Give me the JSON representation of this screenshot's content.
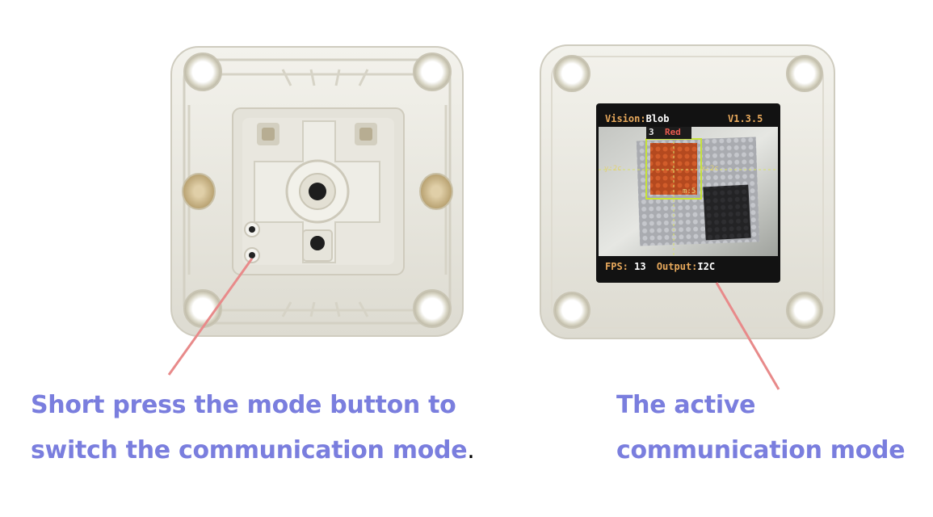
{
  "screen": {
    "vision_label": "Vision:",
    "vision_value": "Blob",
    "version": "V1.3.5",
    "fps_label": "FPS:",
    "fps_value": "13",
    "output_label": "Output:",
    "output_value": "I2C",
    "detect_count": "3",
    "detect_color": "Red",
    "marker_left": "y:2c",
    "marker_right": "x:2c",
    "marker_bottom": "m:5"
  },
  "captions": {
    "left_line1": "Short press the mode button to",
    "left_line2": "switch the communication mode",
    "left_period": ".",
    "right_line1": "The active",
    "right_line2": "communication mode"
  },
  "colors": {
    "caption": "#7a7ede",
    "pointer_line": "#e88a8a",
    "module_body": "#ecebe3",
    "screen_bezel": "#121212",
    "detect_box": "#c6e23a"
  }
}
